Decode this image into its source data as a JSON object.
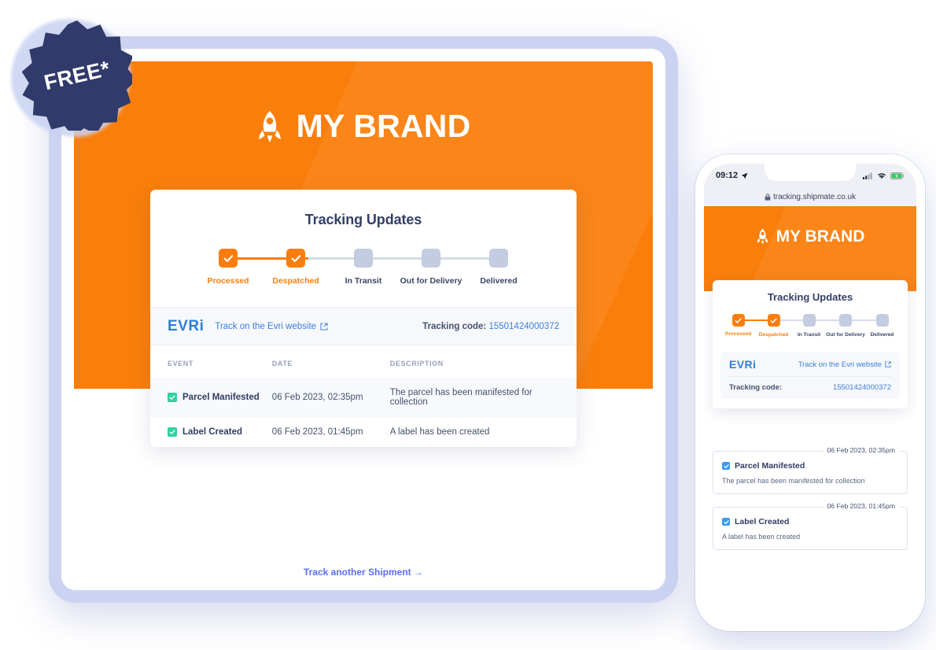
{
  "badge": {
    "label": "FREE*",
    "color": "#303a6b"
  },
  "brand": {
    "name": "MY BRAND",
    "icon": "rocket-icon",
    "header_color": "#fa7e0b"
  },
  "desktop": {
    "card_title": "Tracking Updates",
    "steps": [
      {
        "label": "Processed",
        "state": "done"
      },
      {
        "label": "Despatched",
        "state": "done"
      },
      {
        "label": "In Transit",
        "state": "pending"
      },
      {
        "label": "Out for Delivery",
        "state": "pending"
      },
      {
        "label": "Delivered",
        "state": "pending"
      }
    ],
    "carrier": {
      "logo_main": "EVR",
      "logo_suffix": "i",
      "link_label": "Track on the Evri website",
      "link_icon": "external-link-icon",
      "tracking_label": "Tracking code:",
      "tracking_value": "15501424000372"
    },
    "table": {
      "headers": [
        "EVENT",
        "DATE",
        "DESCRIPTION"
      ],
      "rows": [
        {
          "event": "Parcel Manifested",
          "date": "06 Feb 2023, 02:35pm",
          "description": "The parcel has been manifested for collection"
        },
        {
          "event": "Label Created",
          "date": "06 Feb 2023, 01:45pm",
          "description": "A label has been created"
        }
      ]
    },
    "footer_link": "Track another Shipment →"
  },
  "phone": {
    "status": {
      "time": "09:12",
      "location_icon": "location-arrow-icon",
      "signal_icon": "cellular-signal-icon",
      "wifi_icon": "wifi-icon",
      "battery_icon": "battery-charging-icon"
    },
    "url": "tracking.shipmate.co.uk",
    "url_lock_icon": "lock-icon",
    "card_title": "Tracking Updates",
    "steps": [
      {
        "label": "Processed",
        "state": "done"
      },
      {
        "label": "Despatched",
        "state": "done"
      },
      {
        "label": "In Transit",
        "state": "pending"
      },
      {
        "label": "Out for Delivery",
        "state": "pending"
      },
      {
        "label": "Delivered",
        "state": "pending"
      }
    ],
    "carrier": {
      "logo_main": "EVR",
      "logo_suffix": "i",
      "link_label": "Track on the Evri website",
      "tracking_label": "Tracking code:",
      "tracking_value": "15501424000372"
    },
    "events": [
      {
        "date": "06 Feb 2023, 02:35pm",
        "title": "Parcel Manifested",
        "description": "The parcel has been manifested for collection"
      },
      {
        "date": "06 Feb 2023, 01:45pm",
        "title": "Label Created",
        "description": "A label has been created"
      }
    ]
  },
  "colors": {
    "brand_orange": "#fa7e0b",
    "navy": "#303a6b",
    "link_blue": "#3d7fd6",
    "indigo": "#5b6df0",
    "green": "#2ed3a0",
    "step_pending": "#c3cce0",
    "frame_lavender": "#ccd3f2"
  }
}
